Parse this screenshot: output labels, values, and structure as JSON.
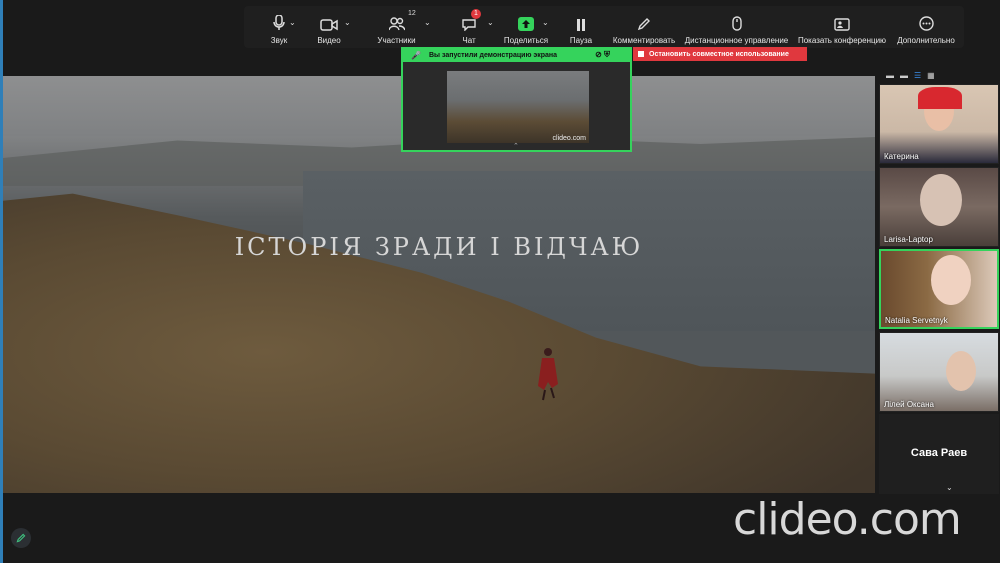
{
  "toolbar": {
    "audio_label": "Звук",
    "video_label": "Видео",
    "participants_label": "Участники",
    "participants_count": "12",
    "chat_label": "Чат",
    "chat_badge": "1",
    "share_label": "Поделиться",
    "pause_label": "Пауза",
    "annotate_label": "Комментировать",
    "remote_control_label": "Дистанционное управление",
    "show_conference_label": "Показать конференцию",
    "more_label": "Дополнительно"
  },
  "share_notice": {
    "title": "Вы запустили демонстрацию экрана",
    "preview_watermark": "clideo.com",
    "stop_button": "Остановить совместное использование"
  },
  "stage": {
    "title_text": "ІСТОРІЯ ЗРАДИ І ВІДЧАЮ"
  },
  "participants": [
    {
      "name": "Катерина"
    },
    {
      "name": "Larisa-Laptop"
    },
    {
      "name": "Natalia Servetnyk"
    },
    {
      "name": "Лілей Оксана"
    },
    {
      "name": "Сава Раев"
    }
  ],
  "watermark": "clideo.com",
  "colors": {
    "accent_green": "#35d35c",
    "stop_red": "#e0383e",
    "edge_blue": "#2f7fb8"
  }
}
